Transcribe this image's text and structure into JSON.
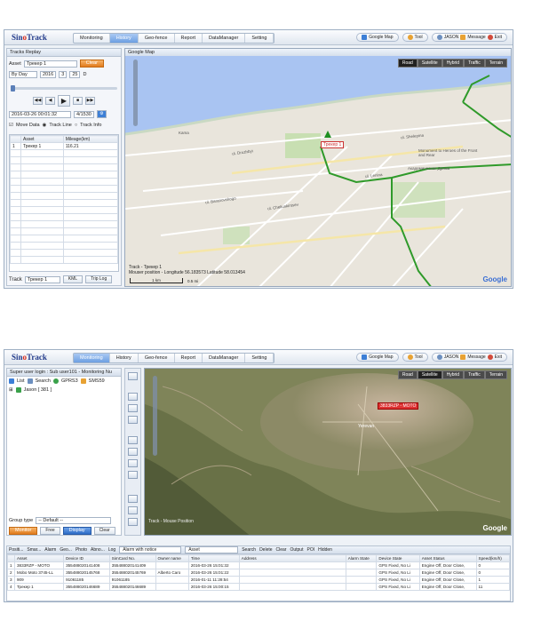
{
  "shot1": {
    "logo": {
      "a": "Sin",
      "b": "o",
      "c": "Track"
    },
    "nav_tabs": [
      "Monitoring",
      "History",
      "Geo-fence",
      "Report",
      "DataManager",
      "Setting"
    ],
    "active_tab": "History",
    "tools": {
      "map": "Google Map",
      "tool": "Tool",
      "user": "JASON",
      "message": "Message",
      "exit": "Exit"
    },
    "panel_title": "Tracks Replay",
    "asset_label": "Asset",
    "asset_value": "Трекер 1",
    "clear_btn": "Clear",
    "by": "By Day",
    "year": "2016",
    "month": "3",
    "day": "25",
    "d_label": "D",
    "date_time": "2016-03-26 00:01:32",
    "counter": "4/1530",
    "move_data": "Move Data",
    "track_line": "Track Line",
    "track_info": "Track Info",
    "table_headers": [
      "Asset",
      "Mileage(km)"
    ],
    "table_rows": [
      [
        "1",
        "Трекер 1",
        "116.21"
      ]
    ],
    "footer": {
      "label": "Track",
      "select": "Трекер 1",
      "kml": "KML",
      "trip": "Trip Log"
    },
    "map": {
      "title": "Google Map",
      "types": [
        "Road",
        "Satellite",
        "Hybrid",
        "Traffic",
        "Terrain"
      ],
      "active_type": "Road",
      "marker": "Трекер 1",
      "status_line1": "Track - Трекер 1",
      "status_line2": "Mouser position - Longitude 56.183573 Latitude 58.013454",
      "scale_top": "1 km",
      "scale_bottom": "0.5 mi",
      "brand": "Google",
      "labels": [
        "Kama",
        "ul. Druzhbyi",
        "ul. Baranovskogo",
        "ul. Cheliuskintsev",
        "ul. Lenina",
        "ul. Shelepina",
        "Академическая Драма",
        "Monument to Heroes of the Front and Rear"
      ]
    }
  },
  "shot2": {
    "logo": {
      "a": "Sin",
      "b": "o",
      "c": "Track"
    },
    "nav_tabs": [
      "Monitoring",
      "History",
      "Geo-fence",
      "Report",
      "DataManager",
      "Setting"
    ],
    "active_tab": "Monitoring",
    "tools": {
      "map": "Google Map",
      "tool": "Tool",
      "user": "JASON",
      "message": "Message",
      "exit": "Exit"
    },
    "user_line": "Super user login : Sub user101 - Monitoring Nu",
    "list_tab": "List",
    "search_tab": "Search",
    "gprs": "GPRS3",
    "sms": "SMS59",
    "tree_root": "Jason [ 381 ]",
    "group_label": "Group type",
    "group_value": "-- Default --",
    "buttons": {
      "monitor": "Monitor",
      "free": "Free",
      "display": "Display",
      "clear": "Clear"
    },
    "map": {
      "types": [
        "Road",
        "Satellite",
        "Hybrid",
        "Traffic",
        "Terrain"
      ],
      "active_type": "Satellite",
      "marker": "3833RZP - MOTO",
      "city_label": "Yerevan",
      "brand": "Google",
      "status": "Track - Mouse Position"
    },
    "bottom_tabs": [
      "Positi...",
      "Smar...",
      "Alarm",
      "Geo...",
      "Photo",
      "Abno...",
      "Log"
    ],
    "alarm_notice": "Alarm with notice",
    "asset_filter": "Asset",
    "bottom_actions": [
      "Search",
      "Delete",
      "Clear",
      "Output",
      "POI",
      "Hidden"
    ],
    "grid_headers": [
      "Asset",
      "Device ID",
      "SimCard No.",
      "Owner name",
      "Time",
      "Address",
      "Alarm State",
      "Device State",
      "Asset Status",
      "Speed(km/h)"
    ],
    "grid_rows": [
      [
        "1",
        "3833RZP - MOTO",
        "355488020141408",
        "355488020141409",
        "",
        "2016-03-26 15:01:32",
        "",
        "",
        "GPS Fixed, No Li",
        "Engine Off, Door Close,",
        "0"
      ],
      [
        "2",
        "Mobo Moto 3745-LL",
        "355488020145768",
        "355488020145769",
        "Alberto Caro",
        "2016-03-26 15:01:22",
        "",
        "",
        "GPS Fixed, No Li",
        "Engine Off, Door Close,",
        "0"
      ],
      [
        "3",
        "909",
        "91061185",
        "91061185",
        "",
        "2016-01-11 11:28:54",
        "",
        "",
        "GPS Fixed, No Li",
        "Engine Off, Door Close,",
        "1"
      ],
      [
        "4",
        "Трекер 1",
        "355488020146689",
        "355488020146689",
        "",
        "2016-03-26 15:00:15",
        "",
        "",
        "GPS Fixed, No Li",
        "Engine Off, Door Close,",
        "11"
      ]
    ]
  }
}
